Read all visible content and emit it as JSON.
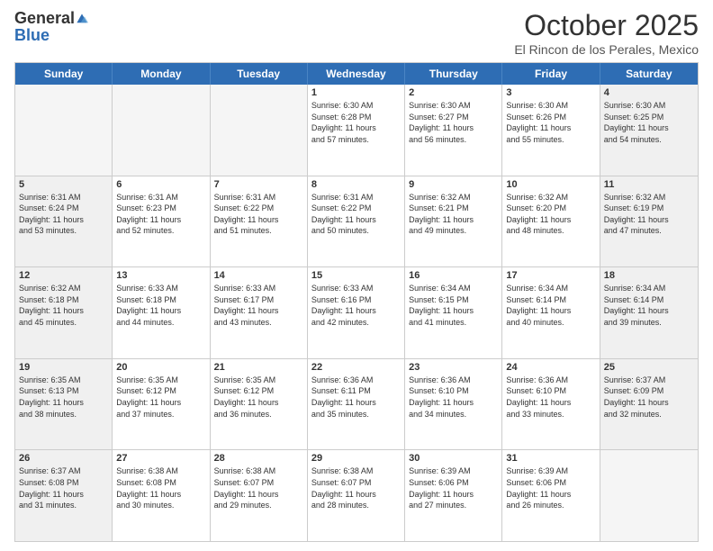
{
  "header": {
    "logo_general": "General",
    "logo_blue": "Blue",
    "month_title": "October 2025",
    "subtitle": "El Rincon de los Perales, Mexico"
  },
  "weekdays": [
    "Sunday",
    "Monday",
    "Tuesday",
    "Wednesday",
    "Thursday",
    "Friday",
    "Saturday"
  ],
  "rows": [
    [
      {
        "day": "",
        "empty": true
      },
      {
        "day": "",
        "empty": true
      },
      {
        "day": "",
        "empty": true
      },
      {
        "day": "1",
        "sunrise": "6:30 AM",
        "sunset": "6:28 PM",
        "daylight": "11 hours and 57 minutes."
      },
      {
        "day": "2",
        "sunrise": "6:30 AM",
        "sunset": "6:27 PM",
        "daylight": "11 hours and 56 minutes."
      },
      {
        "day": "3",
        "sunrise": "6:30 AM",
        "sunset": "6:26 PM",
        "daylight": "11 hours and 55 minutes."
      },
      {
        "day": "4",
        "sunrise": "6:30 AM",
        "sunset": "6:25 PM",
        "daylight": "11 hours and 54 minutes.",
        "shaded": true
      }
    ],
    [
      {
        "day": "5",
        "sunrise": "6:31 AM",
        "sunset": "6:24 PM",
        "daylight": "11 hours and 53 minutes.",
        "shaded": true
      },
      {
        "day": "6",
        "sunrise": "6:31 AM",
        "sunset": "6:23 PM",
        "daylight": "11 hours and 52 minutes."
      },
      {
        "day": "7",
        "sunrise": "6:31 AM",
        "sunset": "6:22 PM",
        "daylight": "11 hours and 51 minutes."
      },
      {
        "day": "8",
        "sunrise": "6:31 AM",
        "sunset": "6:22 PM",
        "daylight": "11 hours and 50 minutes."
      },
      {
        "day": "9",
        "sunrise": "6:32 AM",
        "sunset": "6:21 PM",
        "daylight": "11 hours and 49 minutes."
      },
      {
        "day": "10",
        "sunrise": "6:32 AM",
        "sunset": "6:20 PM",
        "daylight": "11 hours and 48 minutes."
      },
      {
        "day": "11",
        "sunrise": "6:32 AM",
        "sunset": "6:19 PM",
        "daylight": "11 hours and 47 minutes.",
        "shaded": true
      }
    ],
    [
      {
        "day": "12",
        "sunrise": "6:32 AM",
        "sunset": "6:18 PM",
        "daylight": "11 hours and 45 minutes.",
        "shaded": true
      },
      {
        "day": "13",
        "sunrise": "6:33 AM",
        "sunset": "6:18 PM",
        "daylight": "11 hours and 44 minutes."
      },
      {
        "day": "14",
        "sunrise": "6:33 AM",
        "sunset": "6:17 PM",
        "daylight": "11 hours and 43 minutes."
      },
      {
        "day": "15",
        "sunrise": "6:33 AM",
        "sunset": "6:16 PM",
        "daylight": "11 hours and 42 minutes."
      },
      {
        "day": "16",
        "sunrise": "6:34 AM",
        "sunset": "6:15 PM",
        "daylight": "11 hours and 41 minutes."
      },
      {
        "day": "17",
        "sunrise": "6:34 AM",
        "sunset": "6:14 PM",
        "daylight": "11 hours and 40 minutes."
      },
      {
        "day": "18",
        "sunrise": "6:34 AM",
        "sunset": "6:14 PM",
        "daylight": "11 hours and 39 minutes.",
        "shaded": true
      }
    ],
    [
      {
        "day": "19",
        "sunrise": "6:35 AM",
        "sunset": "6:13 PM",
        "daylight": "11 hours and 38 minutes.",
        "shaded": true
      },
      {
        "day": "20",
        "sunrise": "6:35 AM",
        "sunset": "6:12 PM",
        "daylight": "11 hours and 37 minutes."
      },
      {
        "day": "21",
        "sunrise": "6:35 AM",
        "sunset": "6:12 PM",
        "daylight": "11 hours and 36 minutes."
      },
      {
        "day": "22",
        "sunrise": "6:36 AM",
        "sunset": "6:11 PM",
        "daylight": "11 hours and 35 minutes."
      },
      {
        "day": "23",
        "sunrise": "6:36 AM",
        "sunset": "6:10 PM",
        "daylight": "11 hours and 34 minutes."
      },
      {
        "day": "24",
        "sunrise": "6:36 AM",
        "sunset": "6:10 PM",
        "daylight": "11 hours and 33 minutes."
      },
      {
        "day": "25",
        "sunrise": "6:37 AM",
        "sunset": "6:09 PM",
        "daylight": "11 hours and 32 minutes.",
        "shaded": true
      }
    ],
    [
      {
        "day": "26",
        "sunrise": "6:37 AM",
        "sunset": "6:08 PM",
        "daylight": "11 hours and 31 minutes.",
        "shaded": true
      },
      {
        "day": "27",
        "sunrise": "6:38 AM",
        "sunset": "6:08 PM",
        "daylight": "11 hours and 30 minutes."
      },
      {
        "day": "28",
        "sunrise": "6:38 AM",
        "sunset": "6:07 PM",
        "daylight": "11 hours and 29 minutes."
      },
      {
        "day": "29",
        "sunrise": "6:38 AM",
        "sunset": "6:07 PM",
        "daylight": "11 hours and 28 minutes."
      },
      {
        "day": "30",
        "sunrise": "6:39 AM",
        "sunset": "6:06 PM",
        "daylight": "11 hours and 27 minutes."
      },
      {
        "day": "31",
        "sunrise": "6:39 AM",
        "sunset": "6:06 PM",
        "daylight": "11 hours and 26 minutes."
      },
      {
        "day": "",
        "empty": true,
        "shaded": true
      }
    ]
  ],
  "labels": {
    "sunrise": "Sunrise:",
    "sunset": "Sunset:",
    "daylight": "Daylight:"
  }
}
